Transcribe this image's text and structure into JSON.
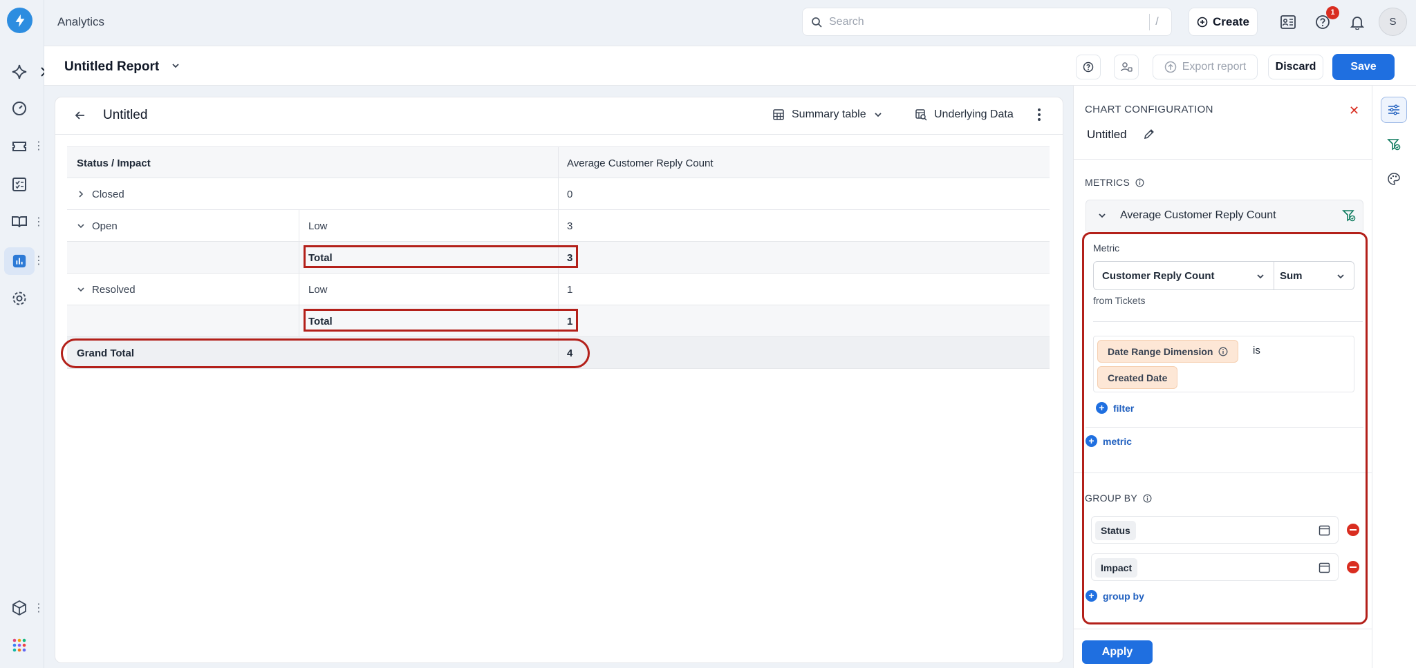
{
  "app": {
    "title": "Analytics"
  },
  "search": {
    "placeholder": "Search",
    "shortcut": "/"
  },
  "topbar": {
    "create_label": "Create",
    "notification_count": "1",
    "avatar_initial": "S"
  },
  "report": {
    "title": "Untitled Report",
    "export_label": "Export report",
    "discard_label": "Discard",
    "save_label": "Save"
  },
  "card": {
    "title": "Untitled",
    "view_label": "Summary table",
    "underlying_label": "Underlying Data"
  },
  "table": {
    "headers": [
      "Status / Impact",
      "Average Customer Reply Count"
    ],
    "rows": [
      {
        "status": "Closed",
        "impact": "",
        "value": "0",
        "type": "collapsed"
      },
      {
        "status": "Open",
        "impact": "Low",
        "value": "3",
        "type": "expanded"
      },
      {
        "status": "",
        "impact": "Total",
        "value": "3",
        "type": "total"
      },
      {
        "status": "Resolved",
        "impact": "Low",
        "value": "1",
        "type": "expanded"
      },
      {
        "status": "",
        "impact": "Total",
        "value": "1",
        "type": "total"
      }
    ],
    "grand_total": {
      "label": "Grand Total",
      "value": "4"
    }
  },
  "config": {
    "title": "CHART CONFIGURATION",
    "chart_name": "Untitled",
    "metrics_label": "METRICS",
    "metric_name": "Average Customer Reply Count",
    "metric_field_label": "Metric",
    "metric_field": "Customer Reply Count",
    "aggregation": "Sum",
    "source": "from Tickets",
    "filter_dimension": "Date Range Dimension",
    "filter_operator": "is",
    "filter_value": "Created Date",
    "add_filter_label": "filter",
    "add_metric_label": "metric",
    "group_by_label": "GROUP BY",
    "group_by": [
      "Status",
      "Impact"
    ],
    "add_group_by_label": "group by",
    "apply_label": "Apply"
  },
  "colors": {
    "accent": "#1f6fe0",
    "highlight": "#b3201a",
    "danger": "#d92d20"
  }
}
